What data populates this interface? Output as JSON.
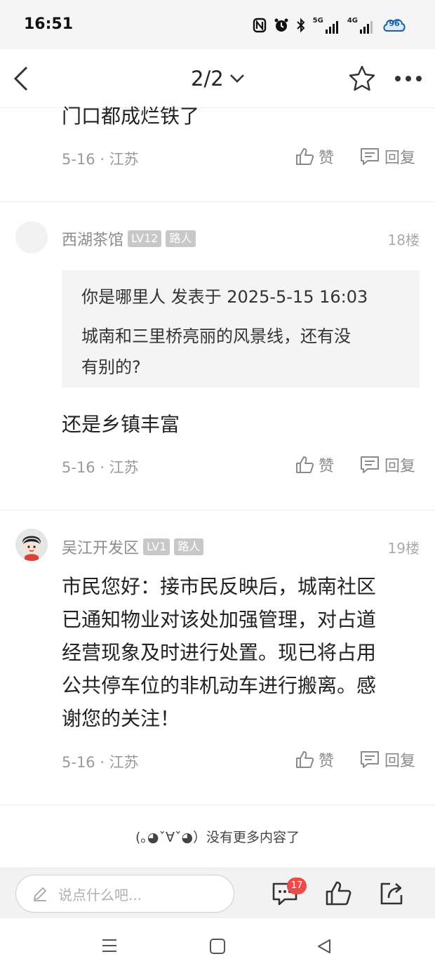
{
  "status_bar": {
    "time": "16:51",
    "network_1": "5G",
    "network_2": "4G",
    "battery_level": "96"
  },
  "top_nav": {
    "page_indicator": "2/2"
  },
  "posts": [
    {
      "text_lines": [
        "门口都成烂铁了"
      ],
      "meta": "5-16 · 江苏",
      "like_label": "赞",
      "reply_label": "回复"
    },
    {
      "username": "西湖茶馆",
      "level": "LV12",
      "role": "路人",
      "floor": "18楼",
      "quote_lines": [
        "你是哪里人 发表于 2025-5-15 16:03",
        "城南和三里桥亮丽的风景线，还有没",
        "有别的?"
      ],
      "text_lines": [
        "还是乡镇丰富"
      ],
      "meta": "5-16 · 江苏",
      "like_label": "赞",
      "reply_label": "回复"
    },
    {
      "username": "吴江开发区",
      "level": "LV1",
      "role": "路人",
      "floor": "19楼",
      "text_lines": [
        "市民您好：接市民反映后，城南社区",
        "已通知物业对该处加强管理，对占道",
        "经营现象及时进行处置。现已将占用",
        "公共停车位的非机动车进行搬离。感",
        "谢您的关注！"
      ],
      "meta": "5-16 · 江苏",
      "like_label": "赞",
      "reply_label": "回复"
    }
  ],
  "end_note": "(｡◕ˇ∀ˇ◕）没有更多内容了",
  "bottom_bar": {
    "input_placeholder": "说点什么吧...",
    "comment_count": "17"
  },
  "icons": [
    "back-icon",
    "chevron-down-icon",
    "star-icon",
    "more-icon",
    "like-icon",
    "reply-icon",
    "pencil-icon",
    "comment-icon",
    "share-icon"
  ]
}
